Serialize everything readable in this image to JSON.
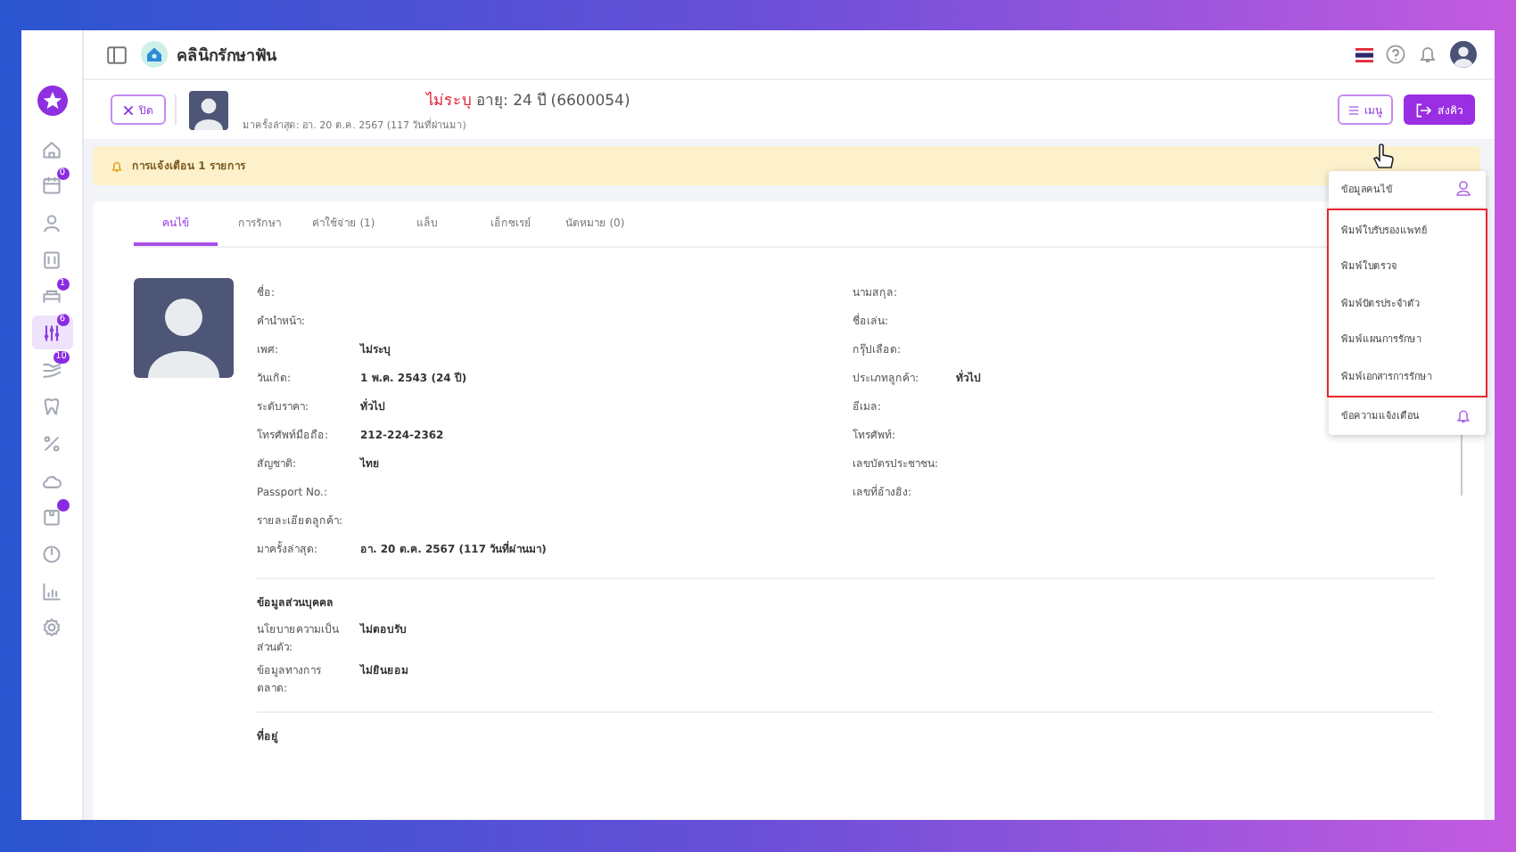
{
  "sidebar": {
    "items": [
      {
        "selected": false
      },
      {
        "selected": false,
        "badge": "0"
      },
      {
        "selected": false
      },
      {
        "selected": false
      },
      {
        "selected": false,
        "badge": "1"
      },
      {
        "selected": true,
        "badge": "6"
      },
      {
        "selected": false,
        "badge": "10"
      },
      {
        "selected": false
      },
      {
        "selected": false
      },
      {
        "selected": false
      },
      {
        "selected": false,
        "dot": true
      },
      {
        "selected": false
      },
      {
        "selected": false
      },
      {
        "selected": false
      }
    ]
  },
  "header": {
    "title": "คลินิกรักษาฟัน"
  },
  "patient": {
    "close_button": "ปิด",
    "gender": "ไม่ระบุ",
    "age": "อายุ: 24 ปี (6600054)",
    "last_visit": "มาครั้งล่าสุด: อา. 20 ต.ค. 2567 (117 วันที่ผ่านมา)",
    "menu_button": "เมนู",
    "send_button": "ส่งคิว"
  },
  "alert": {
    "text": "การแจ้งเตือน 1 รายการ"
  },
  "tabs": [
    {
      "label": "คนไข้",
      "selected": true
    },
    {
      "label": "การรักษา",
      "selected": false
    },
    {
      "label": "ค่าใช้จ่าย (1)",
      "selected": false
    },
    {
      "label": "แล็บ",
      "selected": false
    },
    {
      "label": "เอ็กซเรย์",
      "selected": false
    },
    {
      "label": "นัดหมาย (0)",
      "selected": false
    }
  ],
  "profile": {
    "left_fields": [
      {
        "label": "ชื่อ:"
      },
      {
        "label": "คำนำหน้า:"
      },
      {
        "label": "เพศ:",
        "value": "ไม่ระบุ"
      },
      {
        "label": "วันเกิด:",
        "value": "1 พ.ค. 2543 (24 ปี)"
      },
      {
        "label": "ระดับราคา:",
        "value": "ทั่วไป"
      },
      {
        "label": "โทรศัพท์มือถือ:",
        "value": "212-224-2362"
      },
      {
        "label": "สัญชาติ:",
        "value": "ไทย"
      },
      {
        "label": "Passport No.:"
      },
      {
        "label": "รายละเอียดลูกค้า:"
      },
      {
        "label": "มาครั้งล่าสุด:",
        "value": "อา. 20 ต.ค. 2567 (117 วันที่ผ่านมา)"
      }
    ],
    "right_fields": [
      {
        "label": "นามสกุล:"
      },
      {
        "label": "ชื่อเล่น:"
      },
      {
        "label": "กรุ๊ปเลือด:"
      },
      {
        "label": "ประเภทลูกค้า:",
        "value": "ทั่วไป"
      },
      {
        "label": "อีเมล:"
      },
      {
        "label": "โทรศัพท์:"
      },
      {
        "label": "เลขบัตรประชาชน:"
      },
      {
        "label": "เลขที่อ้างอิง:"
      }
    ]
  },
  "personal": {
    "title": "ข้อมูลส่วนบุคคล",
    "fields": [
      {
        "label": "นโยบายความเป็นส่วนตัว:",
        "value": "ไม่ตอบรับ"
      },
      {
        "label": "ข้อมูลทางการตลาด:",
        "value": "ไม่ยินยอม"
      }
    ]
  },
  "address": {
    "title": "ที่อยู่"
  },
  "menu": {
    "top": "ข้อมูลคนไข้",
    "highlighted": [
      "พิมพ์ใบรับรองแพทย์",
      "พิมพ์ใบตรวจ",
      "พิมพ์บัตรประจำตัว",
      "พิมพ์แผนการรักษา",
      "พิมพ์เอกสารการรักษา"
    ],
    "bottom": "ข้อความแจ้งเตือน"
  }
}
